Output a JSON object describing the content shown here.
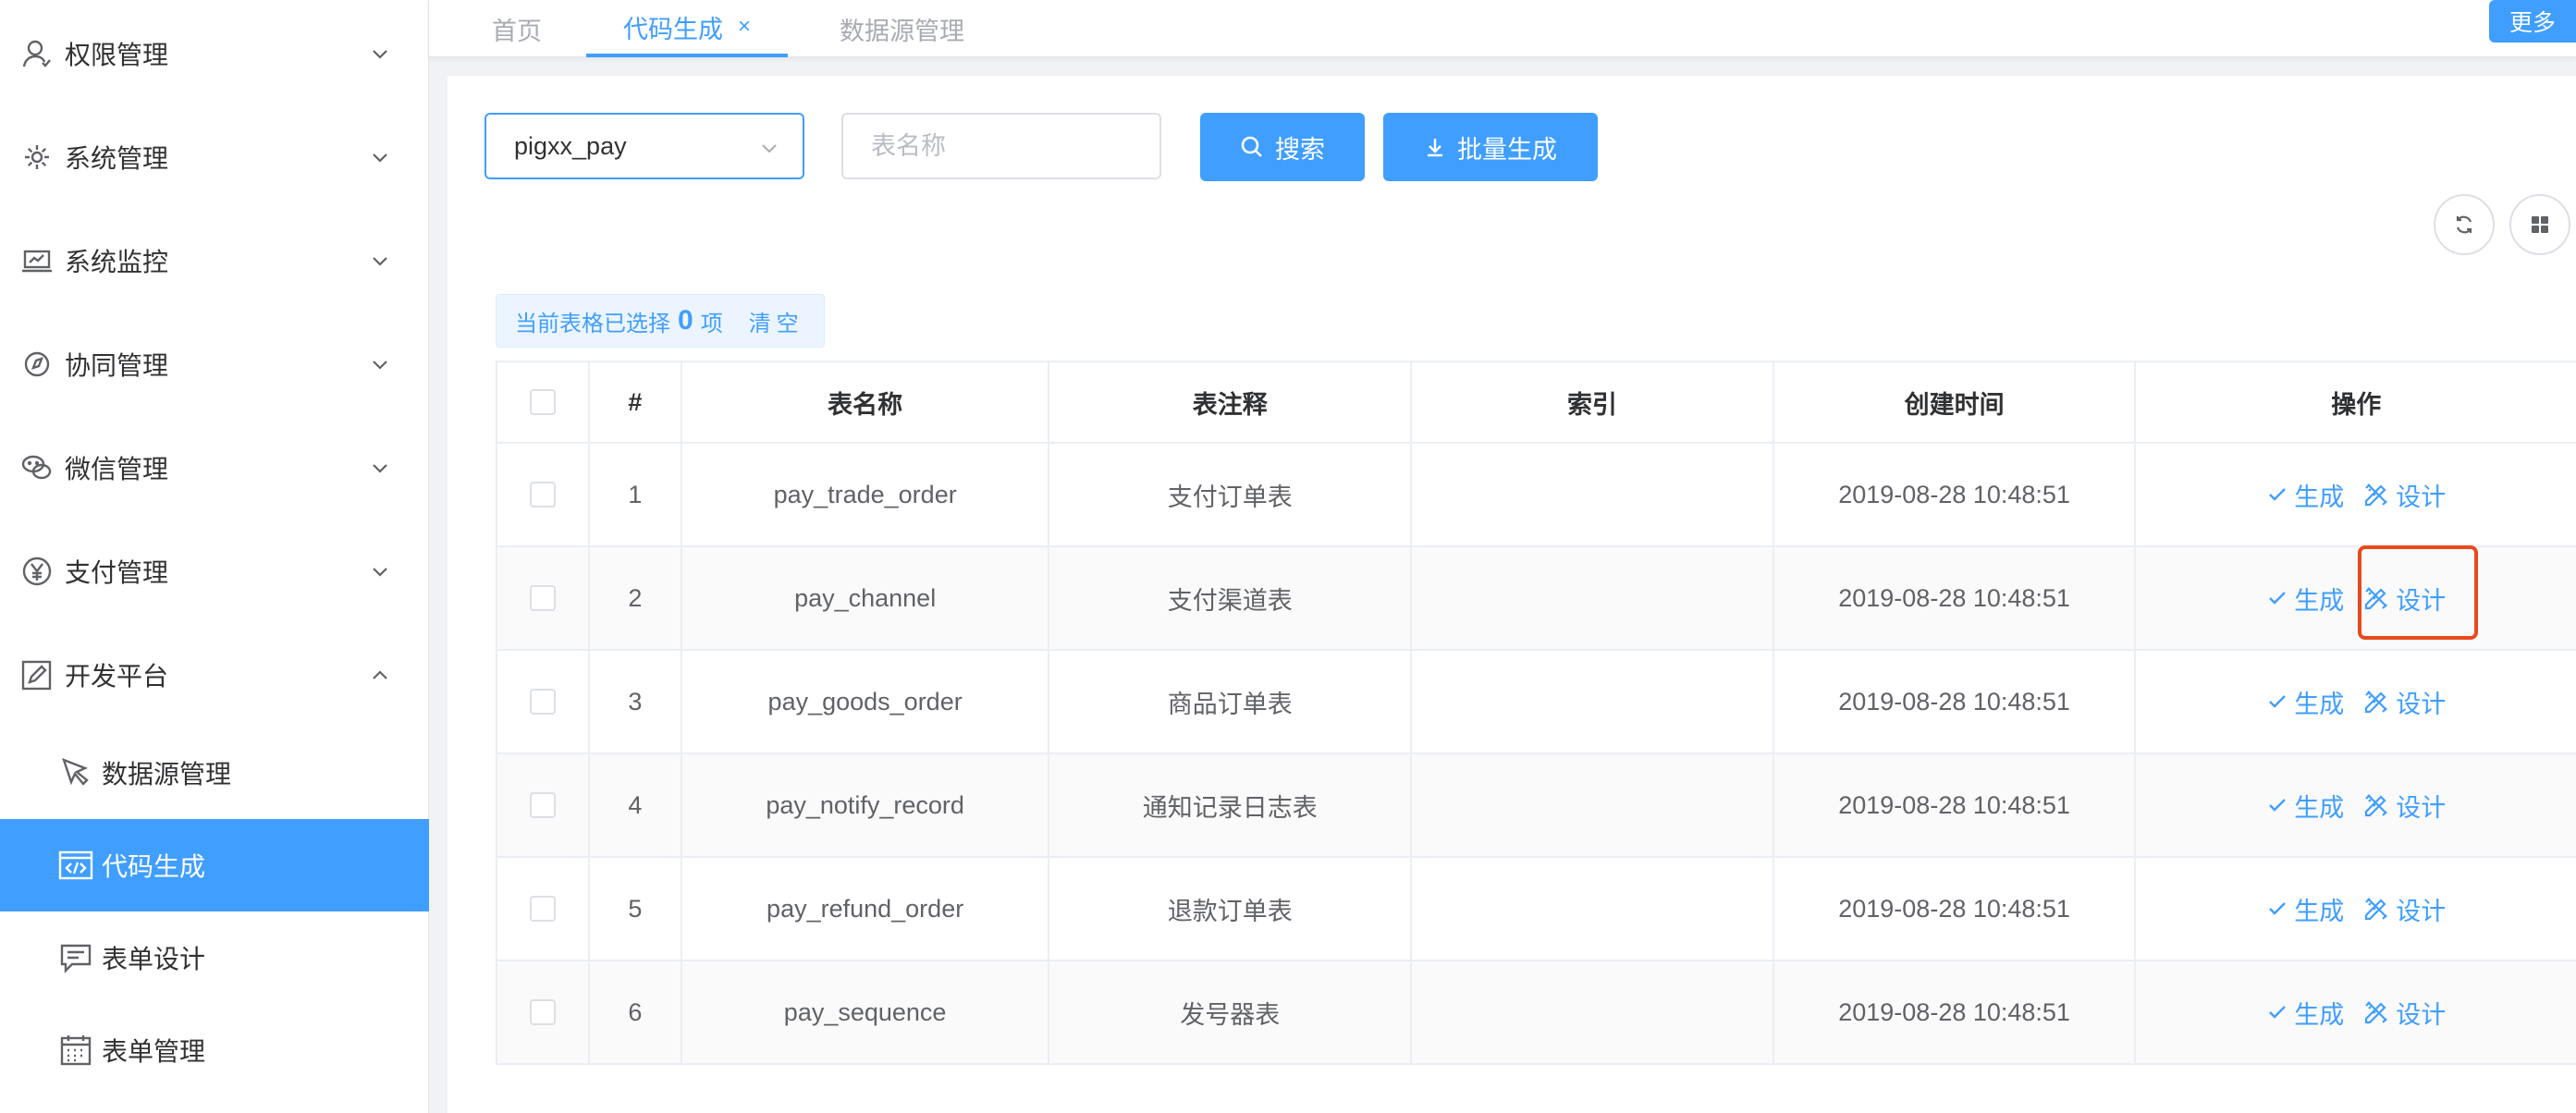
{
  "sidebar": {
    "menus": [
      {
        "label": "权限管理",
        "icon": "user-icon",
        "expanded": false
      },
      {
        "label": "系统管理",
        "icon": "gear-icon",
        "expanded": false
      },
      {
        "label": "系统监控",
        "icon": "monitor-icon",
        "expanded": false
      },
      {
        "label": "协同管理",
        "icon": "compass-icon",
        "expanded": false
      },
      {
        "label": "微信管理",
        "icon": "wechat-icon",
        "expanded": false
      },
      {
        "label": "支付管理",
        "icon": "yen-icon",
        "expanded": false
      },
      {
        "label": "开发平台",
        "icon": "edit-icon",
        "expanded": true
      }
    ],
    "sub_items": [
      {
        "label": "数据源管理",
        "icon": "pointer-icon",
        "active": false
      },
      {
        "label": "代码生成",
        "icon": "code-window-icon",
        "active": true
      },
      {
        "label": "表单设计",
        "icon": "form-icon",
        "active": false
      },
      {
        "label": "表单管理",
        "icon": "calendar-grid-icon",
        "active": false
      }
    ]
  },
  "tabs": [
    {
      "label": "首页",
      "active": false
    },
    {
      "label": "代码生成",
      "active": true,
      "closable": true,
      "close_glyph": "×"
    },
    {
      "label": "数据源管理",
      "active": false
    }
  ],
  "more_label": "更多",
  "toolbar": {
    "datasource_value": "pigxx_pay",
    "table_name_placeholder": "表名称",
    "search_label": "搜索",
    "batch_label": "批量生成"
  },
  "selection": {
    "prefix": "当前表格已选择",
    "count": "0",
    "suffix": "项",
    "clear_label": "清空"
  },
  "table": {
    "headers": [
      "#",
      "表名称",
      "表注释",
      "索引",
      "创建时间",
      "操作"
    ],
    "rows": [
      {
        "index": "1",
        "name": "pay_trade_order",
        "comment": "支付订单表",
        "engine": "",
        "created": "2019-08-28 10:48:51"
      },
      {
        "index": "2",
        "name": "pay_channel",
        "comment": "支付渠道表",
        "engine": "",
        "created": "2019-08-28 10:48:51"
      },
      {
        "index": "3",
        "name": "pay_goods_order",
        "comment": "商品订单表",
        "engine": "",
        "created": "2019-08-28 10:48:51"
      },
      {
        "index": "4",
        "name": "pay_notify_record",
        "comment": "通知记录日志表",
        "engine": "",
        "created": "2019-08-28 10:48:51"
      },
      {
        "index": "5",
        "name": "pay_refund_order",
        "comment": "退款订单表",
        "engine": "",
        "created": "2019-08-28 10:48:51"
      },
      {
        "index": "6",
        "name": "pay_sequence",
        "comment": "发号器表",
        "engine": "",
        "created": "2019-08-28 10:48:51"
      }
    ],
    "op_generate": "生成",
    "op_design": "设计"
  },
  "colors": {
    "primary": "#409eff",
    "highlight": "#e8491d",
    "sidebar_active": "#409eff"
  }
}
